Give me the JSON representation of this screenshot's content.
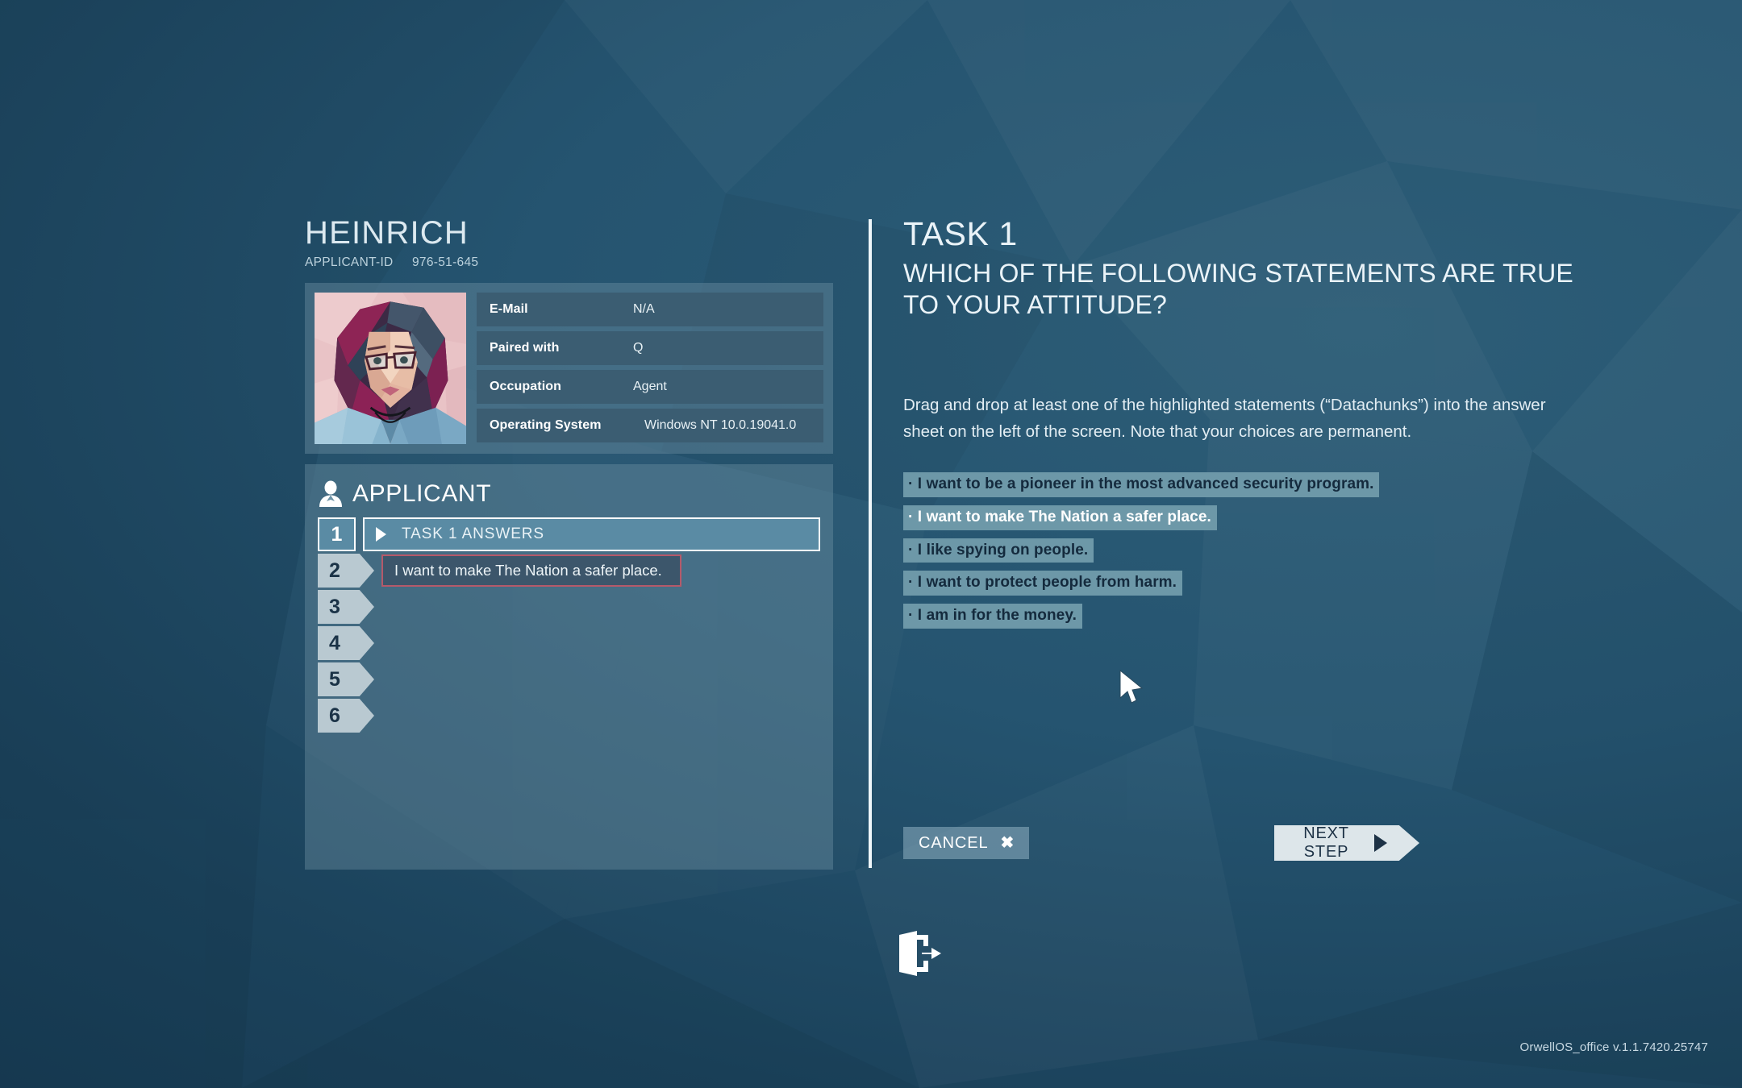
{
  "applicant": {
    "name": "HEINRICH",
    "id_label": "APPLICANT-ID",
    "id_value": "976-51-645",
    "info_rows": [
      {
        "label": "E-Mail",
        "value": "N/A"
      },
      {
        "label": "Paired with",
        "value": "Q"
      },
      {
        "label": "Occupation",
        "value": "Agent"
      },
      {
        "label": "Operating System",
        "value": "Windows NT 10.0.19041.0"
      }
    ]
  },
  "answer_sheet": {
    "header_title": "APPLICANT",
    "header_icon": "user-icon",
    "slots": [
      {
        "number": "1",
        "type": "header",
        "text": "TASK 1 ANSWERS"
      },
      {
        "number": "2",
        "type": "filled",
        "text": "I want to make The Nation a safer place."
      },
      {
        "number": "3",
        "type": "empty",
        "text": ""
      },
      {
        "number": "4",
        "type": "empty",
        "text": ""
      },
      {
        "number": "5",
        "type": "empty",
        "text": ""
      },
      {
        "number": "6",
        "type": "empty",
        "text": ""
      }
    ]
  },
  "task": {
    "title": "TASK 1",
    "question": "WHICH OF THE FOLLOWING STATEMENTS ARE TRUE TO YOUR ATTITUDE?",
    "instructions": "Drag and drop at least one of the highlighted statements (“Datachunks”) into the answer sheet on the left of the screen. Note that your choices are permanent.",
    "datachunks": [
      {
        "text": "· I want to be a pioneer in the most advanced security program.",
        "used": false
      },
      {
        "text": "· I want to make The Nation a safer place.",
        "used": true
      },
      {
        "text": "· I like spying on people.",
        "used": false
      },
      {
        "text": "· I want to protect people from harm.",
        "used": false
      },
      {
        "text": "· I am in for the money.",
        "used": false
      }
    ]
  },
  "buttons": {
    "cancel_label": "CANCEL",
    "cancel_icon": "close-x-icon",
    "next_label": "NEXT STEP",
    "next_icon": "arrow-right-icon"
  },
  "footer": {
    "logout_icon": "logout-door-icon",
    "version": "OrwellOS_office v.1.1.7420.25747"
  },
  "colors": {
    "background_dark": "#13324a",
    "background_light": "#2d5d77",
    "panel": "#6d93a6",
    "info_row": "#3b5d72",
    "accent_active": "#5a8ba4",
    "answer_border": "#b5596a",
    "chunk_highlight": "#6d98a8",
    "next_button": "#dde6ea"
  }
}
